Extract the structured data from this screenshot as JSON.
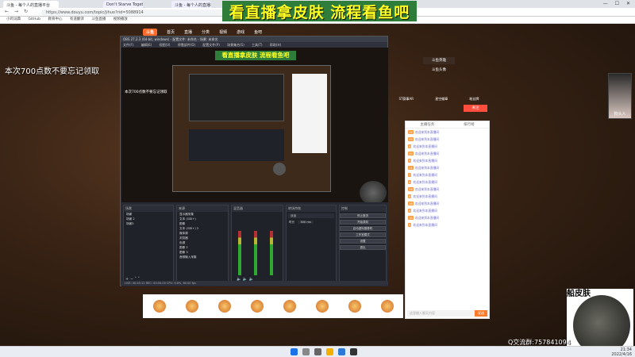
{
  "browser": {
    "tabs": [
      "斗鱼 - 每个人的直播平台",
      "Don't Starve Togeth…",
      "斗鱼 - 每个人的直播平台"
    ],
    "url": "https://www.douyu.com/topic/jihuo?rid=5088914",
    "bookmarks": [
      "小鸡词典",
      "GitHub",
      "教育中心",
      "有道翻译",
      "斗鱼直播",
      "视频播放"
    ]
  },
  "site": {
    "logo": "斗鱼",
    "nav": [
      "首页",
      "直播",
      "分类",
      "视频",
      "游戏",
      "鱼吧"
    ],
    "right_tiles": [
      "斗鱼英雄",
      "斗鱼头像"
    ],
    "follow_label": "关注",
    "gift_labels": [
      "ST赛事AR",
      "星空徽章",
      "粉丝牌"
    ],
    "chat_tabs": [
      "主播任务",
      "排行榜"
    ],
    "chat_lines": [
      {
        "badge": "12",
        "text": "欢迎来到本直播间"
      },
      {
        "badge": "15",
        "text": "欢迎来到本直播间"
      },
      {
        "badge": "8",
        "text": "欢迎来到本直播间"
      },
      {
        "badge": "20",
        "text": "欢迎来到本直播间"
      },
      {
        "badge": "3",
        "text": "欢迎来到本直播间"
      },
      {
        "badge": "11",
        "text": "欢迎来到本直播间"
      },
      {
        "badge": "7",
        "text": "欢迎来到本直播间"
      },
      {
        "badge": "9",
        "text": "欢迎来到本直播间"
      },
      {
        "badge": "14",
        "text": "欢迎来到本直播间"
      },
      {
        "badge": "6",
        "text": "欢迎来到本直播间"
      },
      {
        "badge": "18",
        "text": "欢迎来到本直播间"
      },
      {
        "badge": "4",
        "text": "欢迎来到本直播间"
      },
      {
        "badge": "10",
        "text": "欢迎来到本直播间"
      },
      {
        "badge": "5",
        "text": "欢迎来到本直播间"
      }
    ],
    "chat_placeholder": "这里输入聊天内容",
    "send_label": "发送"
  },
  "overlay": {
    "banner": "看直播拿皮肤 流程看鱼吧",
    "notice": "本次700点数不要忘记领取",
    "side_avatar": "狗头人",
    "skin_title": "船皮肤",
    "qq_group": "Q交流群:757841094"
  },
  "obs": {
    "title": "OBS 27.2.3 (64-bit, windows) - 配置文件: 未命名 - 场景: 未命名",
    "menu": [
      "文件(F)",
      "编辑(E)",
      "视图(V)",
      "停靠部件(D)",
      "配置文件(P)",
      "场景集合(S)",
      "工具(T)",
      "帮助(H)"
    ],
    "preview_banner": "看直播拿皮肤 流程看鱼吧",
    "preview_notice": "本次700点数不要忘记领取",
    "docks": {
      "scenes_title": "场景",
      "scenes": [
        "场景",
        "场景 2",
        "场景3"
      ],
      "sources_title": "来源",
      "sources": [
        "显示器采集",
        "文本 (GDI+)",
        "图像",
        "文本 (GDI+) 2",
        "媒体源",
        "浏览器",
        "色源",
        "图像 2",
        "图像 3",
        "音频输入采集"
      ],
      "mixer_title": "混音器",
      "transitions_title": "转场特效",
      "transition_value": "淡出",
      "duration_label": "时长",
      "duration_value": "300 ms",
      "controls_title": "控制",
      "controls": [
        "停止推流",
        "开始录制",
        "启动虚拟摄像机",
        "工作室模式",
        "设置",
        "退出"
      ]
    },
    "status": "LIVE: 00:45:12   REC: 00:00:00   CPU: 9.8%, 60.00 fps"
  },
  "taskbar": {
    "time": "21:34",
    "date": "2022/4/16"
  }
}
